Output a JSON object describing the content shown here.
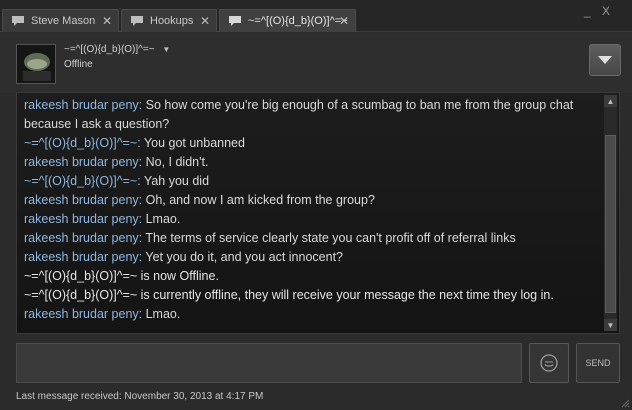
{
  "tabs": [
    {
      "label": "Steve Mason",
      "icon": "chat-bubble-icon",
      "active": false
    },
    {
      "label": "Hookups",
      "icon": "chat-bubble-icon",
      "active": false
    },
    {
      "label": "~=^[(O){d_b}(O)]^=~",
      "icon": "chat-bubble-icon",
      "active": true
    }
  ],
  "window_controls": {
    "minimize": "_",
    "close": "X"
  },
  "header": {
    "friend_name": "~=^[(O){d_b}(O)]^=~",
    "status": "Offline"
  },
  "messages": [
    {
      "sender": "rakeesh brudar peny",
      "kind": "other",
      "text": "So how come you're big enough of a scumbag to ban me from the group chat because I ask a question?"
    },
    {
      "sender": "~=^[(O){d_b}(O)]^=~",
      "kind": "other",
      "text": "You got unbanned"
    },
    {
      "sender": "rakeesh brudar peny",
      "kind": "other",
      "text": "No, I didn't."
    },
    {
      "sender": "~=^[(O){d_b}(O)]^=~",
      "kind": "other",
      "text": "Yah you did"
    },
    {
      "sender": "rakeesh brudar peny",
      "kind": "other",
      "text": "Oh, and now I am kicked from the group?"
    },
    {
      "sender": "rakeesh brudar peny",
      "kind": "other",
      "text": "Lmao."
    },
    {
      "sender": "rakeesh brudar peny",
      "kind": "other",
      "text": "The terms of service clearly state you can't profit off of referral links"
    },
    {
      "sender": "rakeesh brudar peny",
      "kind": "other",
      "text": "Yet you do it, and you act innocent?"
    },
    {
      "sender": "",
      "kind": "system",
      "text": "~=^[(O){d_b}(O)]^=~ is now Offline."
    },
    {
      "sender": "",
      "kind": "system",
      "text": "~=^[(O){d_b}(O)]^=~ is currently offline, they will receive your message the next time they log in."
    },
    {
      "sender": "rakeesh brudar peny",
      "kind": "other",
      "text": "Lmao."
    }
  ],
  "input": {
    "value": "",
    "placeholder": ""
  },
  "send_label": "SEND",
  "footer": {
    "last_received": "Last message received: November 30, 2013 at 4:17 PM"
  },
  "colors": {
    "sender_name": "#8fb7e0",
    "text": "#d9d9d9",
    "background": "#2b2b2b"
  }
}
